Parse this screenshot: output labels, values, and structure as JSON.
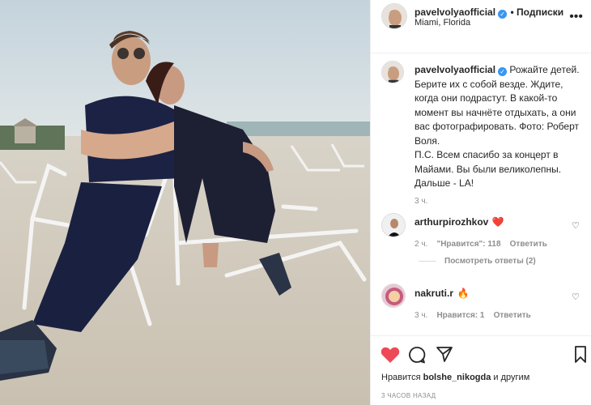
{
  "post": {
    "username": "pavelvolyaofficial",
    "follow_label": "• Подписки",
    "location": "Miami, Florida",
    "more_icon": "more-horizontal-icon"
  },
  "caption": {
    "username": "pavelvolyaofficial",
    "text": "Рожайте детей. Берите их с собой везде. Ждите, когда они подрастут. В какой-то момент вы начнёте отдыхать, а они вас фотографировать. Фото: Роберт Воля. П.С. Всем спасибо за концерт в Майами. Вы были великолепны. Дальше - LA!",
    "text_lines": [
      "Рожайте детей.",
      "Берите их с собой везде. Ждите,",
      "когда они подрастут. В какой-то",
      "момент вы начнёте отдыхать, а они",
      "вас фотографировать. Фото: Роберт",
      "Воля.",
      "П.С. Всем спасибо за концерт в",
      "Майами. Вы были великолепны.",
      "Дальше - LA!"
    ],
    "time": "3 ч."
  },
  "comments": [
    {
      "username": "arthurpirozhkov",
      "text": "❤️",
      "time": "2 ч.",
      "likes": "\"Нравится\": 118",
      "reply_label": "Ответить",
      "view_replies": "Посмотреть ответы (2)"
    },
    {
      "username": "nakruti.r",
      "text": "🔥",
      "time": "3 ч.",
      "likes": "Нравится: 1",
      "reply_label": "Ответить"
    }
  ],
  "actions": {
    "liked_by_prefix": "Нравится",
    "liked_by_user": "bolshe_nikogda",
    "liked_by_suffix": "и другим",
    "timestamp": "3 ЧАСОВ НАЗАД"
  },
  "colors": {
    "like_red": "#ed4956",
    "verified_blue": "#3897f0",
    "meta_gray": "#8e8e8e"
  }
}
